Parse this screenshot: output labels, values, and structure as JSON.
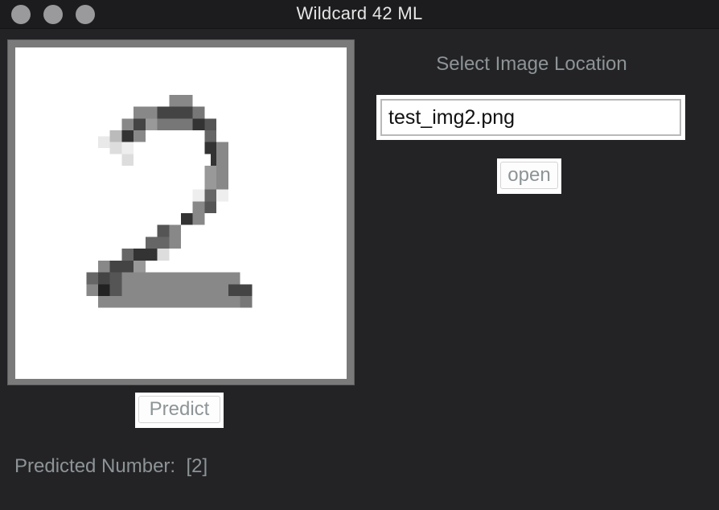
{
  "window": {
    "title": "Wildcard 42 ML"
  },
  "canvas": {
    "digit_image": "handwritten digit 2 (pixelated grayscale)"
  },
  "buttons": {
    "predict_label": "Predict",
    "open_label": "open"
  },
  "prediction": {
    "label": "Predicted Number:",
    "value": "[2]"
  },
  "file_select": {
    "label": "Select Image Location",
    "path_value": "test_img2.png"
  },
  "colors": {
    "background": "#232326",
    "text_muted": "#8d9496",
    "canvas_bg": "#ffffff",
    "frame": "#7a7a7a"
  }
}
